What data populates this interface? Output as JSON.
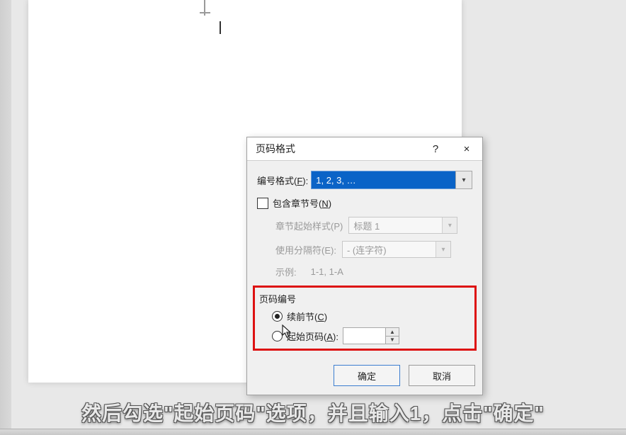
{
  "dialog": {
    "title": "页码格式",
    "help": "?",
    "close": "×",
    "format_label_pre": "编号格式(",
    "format_hotkey": "F",
    "format_label_post": "):",
    "format_value": "1, 2, 3, …",
    "include_chapter_pre": "包含章节号(",
    "include_chapter_hotkey": "N",
    "include_chapter_post": ")",
    "chapter_style_label": "章节起始样式(P)",
    "chapter_style_value": "标题 1",
    "separator_label": "使用分隔符(E):",
    "separator_value": "-   (连字符)",
    "example_label": "示例:",
    "example_value": "1-1, 1-A",
    "group_title": "页码编号",
    "continue_pre": "续前节(",
    "continue_hotkey": "C",
    "continue_post": ")",
    "start_at_pre": "起始页码(",
    "start_at_hotkey": "A",
    "start_at_post": "):",
    "start_at_value": "",
    "ok": "确定",
    "cancel": "取消"
  },
  "subtitle": "然后勾选\"起始页码\"选项，并且输入1，点击\"确定\""
}
